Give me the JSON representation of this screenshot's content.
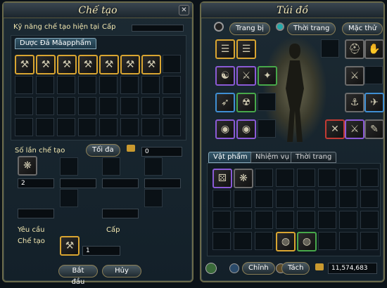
{
  "craft": {
    "title": "Chế tạo",
    "skill_label": "Kỹ năng chế tạo hiện tại",
    "level_label": "Cấp",
    "recipe_tab": "Dược Đả Mãapphẩm",
    "times_label": "Số lần chế tạo",
    "max_btn": "Tối đa",
    "money": "0",
    "material_qty": "2",
    "require_label": "Yêu cầu",
    "require_level_label": "Cấp",
    "craft_label": "Chế tạo",
    "result_qty": "1",
    "start_btn": "Bắt đầu",
    "cancel_btn": "Hủy"
  },
  "bag": {
    "title": "Túi đồ",
    "equip_tab": "Trang bị",
    "fashion_tab": "Thời trang",
    "wear_tab": "Mặc thử",
    "tabs": [
      "Vật phẩm",
      "Nhiệm vụ",
      "Thời trang"
    ],
    "btn_combine": "Chỉnh",
    "btn_split": "Tách",
    "gold": "11,574,683"
  },
  "colors": {
    "gold_border": "#d9a531",
    "purple": "#8a5ad6"
  }
}
